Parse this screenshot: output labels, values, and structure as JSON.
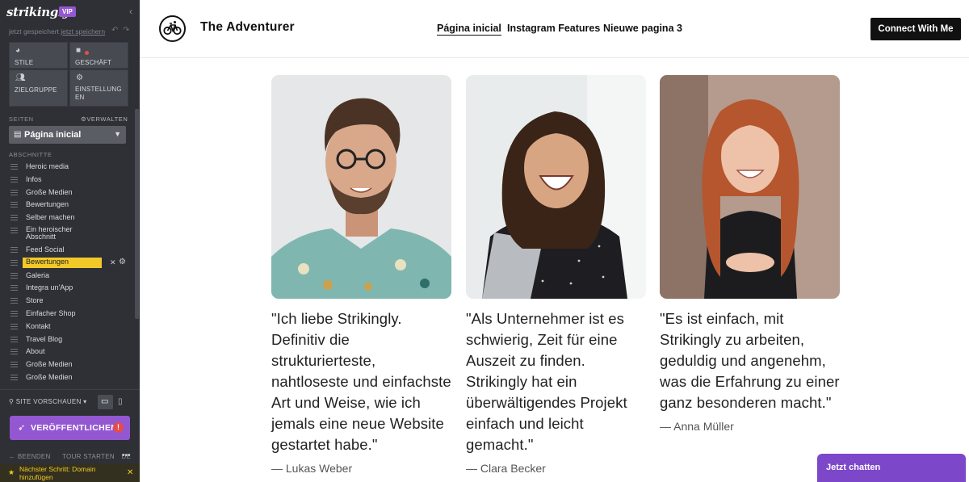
{
  "editor": {
    "logo": "strikingly",
    "vip_badge": "VIP",
    "saved_text": "jetzt gespeichert",
    "save_link": "jetzt speichern",
    "tiles": [
      {
        "label": "STILE",
        "icon": "palette-icon"
      },
      {
        "label": "GESCHÄFT",
        "icon": "bag-icon"
      },
      {
        "label": "ZIELGRUPPE",
        "icon": "people-icon"
      },
      {
        "label": "EINSTELLUNGEN",
        "label_line1": "EINSTELLUNG",
        "label_line2": "EN",
        "icon": "gear-icon"
      }
    ],
    "pages_header": "SEITEN",
    "manage_label": "VERWALTEN",
    "current_page": "Página inicial",
    "sections_header": "ABSCHNITTE",
    "sections": [
      "Heroic media",
      "Infos",
      "Große Medien",
      "Bewertungen",
      "Selber machen",
      "Ein heroischer Abschnitt",
      "Feed Social",
      "Bewertungen",
      "Galeria",
      "Integra un'App",
      "Store",
      "Einfacher Shop",
      "Kontakt",
      "Travel Blog",
      "About",
      "Große Medien",
      "Große Medien"
    ],
    "active_section_index": 7,
    "site_preview": "SITE VORSCHAUEN",
    "publish": "VERÖFFENTLICHEN",
    "publish_warning": "!",
    "footer_links": [
      "BEENDEN",
      "TOUR STARTEN",
      "DE"
    ],
    "next_step": "Nächster Schritt: Domain hinzufügen",
    "accent": "#9357d2",
    "highlight": "#f2c928"
  },
  "site": {
    "title": "The Adventurer",
    "nav": [
      "Página inicial",
      "Instagram Features",
      "Nieuwe pagina 3"
    ],
    "cta": "Connect With Me",
    "testimonials": [
      {
        "quote": "\"Ich liebe Strikingly. Definitiv die strukturierteste, nahtloseste und einfachste Art und Weise, wie ich jemals eine neue Website gestartet habe.\"",
        "author": "— Lukas Weber"
      },
      {
        "quote": "\"Als Unternehmer ist es schwierig, Zeit für eine Auszeit zu finden. Strikingly hat ein überwältigendes Projekt einfach und leicht gemacht.\"",
        "author": "— Clara Becker"
      },
      {
        "quote": "\"Es ist einfach, mit Strikingly zu arbeiten, geduldig und angenehm, was die Erfahrung zu einer ganz besonderen macht.\"",
        "author": "— Anna Müller"
      }
    ],
    "chat_label": "Jetzt chatten"
  }
}
